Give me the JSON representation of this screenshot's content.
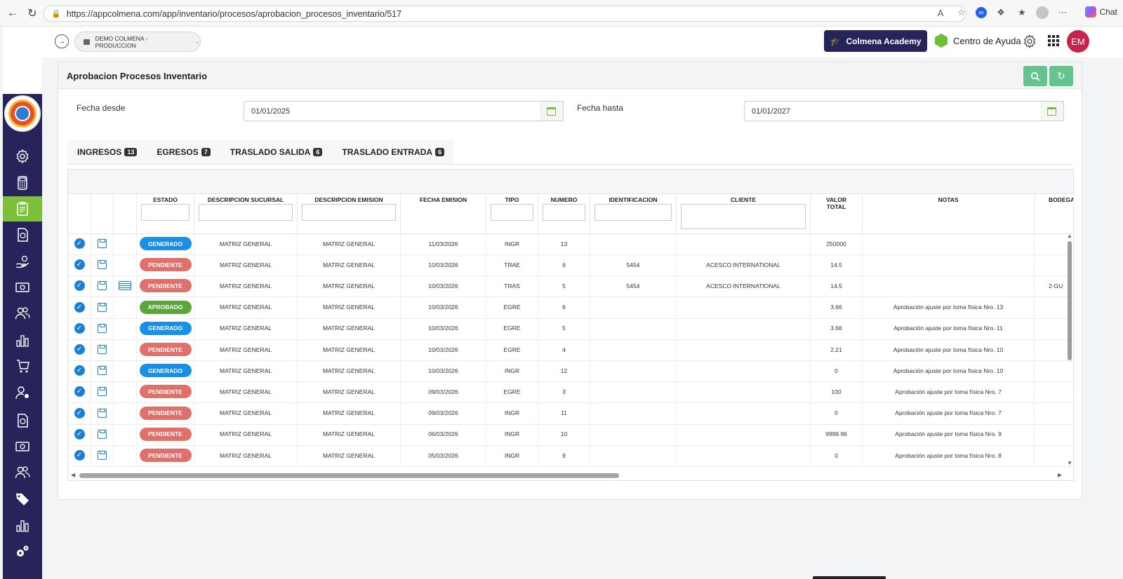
{
  "browser": {
    "url": "https://appcolmena.com/app/inventario/procesos/aprobacion_procesos_inventario/517",
    "chat_label": "Chat"
  },
  "header": {
    "company": "DEMO COLMENA - PRODUCCION",
    "academy_label": "Colmena Academy",
    "help_label": "Centro de Ayuda",
    "user_initials": "EM"
  },
  "page": {
    "title": "Aprobacion Procesos Inventario",
    "fecha_desde_label": "Fecha desde",
    "fecha_desde_value": "01/01/2025",
    "fecha_hasta_label": "Fecha hasta",
    "fecha_hasta_value": "01/01/2027"
  },
  "tabs": [
    {
      "label": "INGRESOS",
      "count": "13"
    },
    {
      "label": "EGRESOS",
      "count": "7"
    },
    {
      "label": "TRASLADO SALIDA",
      "count": "6"
    },
    {
      "label": "TRASLADO ENTRADA",
      "count": "6"
    }
  ],
  "columns": {
    "estado": "ESTADO",
    "sucursal": "DESCRIPCION SUCURSAL",
    "emision": "DESCRIPCION EMISION",
    "fecha": "FECHA EMISION",
    "tipo": "TIPO",
    "numero": "NUMERO",
    "identificacion": "IDENTIFICACION",
    "cliente": "CLIENTE",
    "valor_1": "VALOR",
    "valor_2": "TOTAL",
    "notas": "NOTAS",
    "bodega": "BODEGA"
  },
  "rows": [
    {
      "estado": "GENERADO",
      "sucursal": "MATRIZ GENERAL",
      "emision": "MATRIZ GENERAL",
      "fecha": "11/03/2026",
      "tipo": "INGR",
      "numero": "13",
      "identificacion": "",
      "cliente": "",
      "valor": "250000",
      "notas": "",
      "bodega": ""
    },
    {
      "estado": "PENDIENTE",
      "sucursal": "MATRIZ GENERAL",
      "emision": "MATRIZ GENERAL",
      "fecha": "10/03/2026",
      "tipo": "TRAE",
      "numero": "6",
      "identificacion": "5454",
      "cliente": "ACESCO INTERNATIONAL",
      "valor": "14.5",
      "notas": "",
      "bodega": ""
    },
    {
      "estado": "PENDIENTE",
      "sucursal": "MATRIZ GENERAL",
      "emision": "MATRIZ GENERAL",
      "fecha": "10/03/2026",
      "tipo": "TRAS",
      "numero": "5",
      "identificacion": "5454",
      "cliente": "ACESCO INTERNATIONAL",
      "valor": "14.5",
      "notas": "",
      "bodega": "2-GU"
    },
    {
      "estado": "APROBADO",
      "sucursal": "MATRIZ GENERAL",
      "emision": "MATRIZ GENERAL",
      "fecha": "10/03/2026",
      "tipo": "EGRE",
      "numero": "6",
      "identificacion": "",
      "cliente": "",
      "valor": "3.66",
      "notas": "Aprobación ajuste por toma física Nro. 13",
      "bodega": ""
    },
    {
      "estado": "GENERADO",
      "sucursal": "MATRIZ GENERAL",
      "emision": "MATRIZ GENERAL",
      "fecha": "10/03/2026",
      "tipo": "EGRE",
      "numero": "5",
      "identificacion": "",
      "cliente": "",
      "valor": "3.66",
      "notas": "Aprobación ajuste por toma física Nro. 11",
      "bodega": ""
    },
    {
      "estado": "PENDIENTE",
      "sucursal": "MATRIZ GENERAL",
      "emision": "MATRIZ GENERAL",
      "fecha": "10/03/2026",
      "tipo": "EGRE",
      "numero": "4",
      "identificacion": "",
      "cliente": "",
      "valor": "2.21",
      "notas": "Aprobación ajuste por toma física Nro. 10",
      "bodega": ""
    },
    {
      "estado": "GENERADO",
      "sucursal": "MATRIZ GENERAL",
      "emision": "MATRIZ GENERAL",
      "fecha": "10/03/2026",
      "tipo": "INGR",
      "numero": "12",
      "identificacion": "",
      "cliente": "",
      "valor": "0",
      "notas": "Aprobación ajuste por toma física Nro. 10",
      "bodega": ""
    },
    {
      "estado": "PENDIENTE",
      "sucursal": "MATRIZ GENERAL",
      "emision": "MATRIZ GENERAL",
      "fecha": "09/03/2026",
      "tipo": "EGRE",
      "numero": "3",
      "identificacion": "",
      "cliente": "",
      "valor": "100",
      "notas": "Aprobación ajuste por toma física Nro. 7",
      "bodega": ""
    },
    {
      "estado": "PENDIENTE",
      "sucursal": "MATRIZ GENERAL",
      "emision": "MATRIZ GENERAL",
      "fecha": "09/03/2026",
      "tipo": "INGR",
      "numero": "11",
      "identificacion": "",
      "cliente": "",
      "valor": "0",
      "notas": "Aprobación ajuste por toma física Nro. 7",
      "bodega": ""
    },
    {
      "estado": "PENDIENTE",
      "sucursal": "MATRIZ GENERAL",
      "emision": "MATRIZ GENERAL",
      "fecha": "06/03/2026",
      "tipo": "INGR",
      "numero": "10",
      "identificacion": "",
      "cliente": "",
      "valor": "9999.96",
      "notas": "Aprobación ajuste por toma física Nro. 9",
      "bodega": ""
    },
    {
      "estado": "PENDIENTE",
      "sucursal": "MATRIZ GENERAL",
      "emision": "MATRIZ GENERAL",
      "fecha": "05/03/2026",
      "tipo": "INGR",
      "numero": "9",
      "identificacion": "",
      "cliente": "",
      "valor": "0",
      "notas": "Aprobación ajuste por toma física Nro. 8",
      "bodega": ""
    }
  ],
  "sidebar_icons": [
    "gear-icon",
    "calculator-icon",
    "clipboard-icon",
    "invoice-icon",
    "hand-money-icon",
    "cash-icon",
    "users-icon",
    "bar-chart-icon",
    "cart-icon",
    "user-settings-icon",
    "invoice-icon",
    "cash-icon",
    "users-icon",
    "tags-icon",
    "bar-chart-icon",
    "gears-icon"
  ],
  "colors": {
    "sidebar": "#26245a",
    "active": "#7bbf3a",
    "generado": "#1a8fe8",
    "pendiente": "#e0706a",
    "aprobado": "#5aa63b",
    "action": "#65c48e"
  }
}
